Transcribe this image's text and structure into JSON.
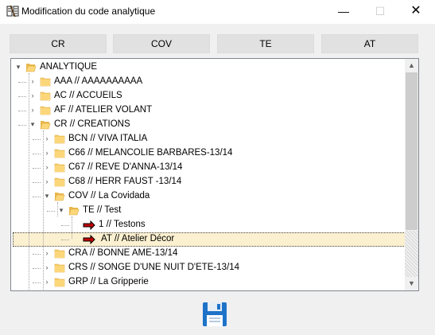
{
  "window": {
    "title": "Modification du code analytique",
    "minimize": "—",
    "maximize": "☐",
    "close": "✕"
  },
  "tabs": [
    "CR",
    "COV",
    "TE",
    "AT"
  ],
  "tree": {
    "rows": [
      {
        "label": "ANALYTIQUE",
        "icon": "folder-open-icon"
      },
      {
        "label": "AAA  // AAAAAAAAAA",
        "icon": "folder-icon"
      },
      {
        "label": "AC  // ACCUEILS",
        "icon": "folder-icon"
      },
      {
        "label": "AF  // ATELIER VOLANT",
        "icon": "folder-icon"
      },
      {
        "label": "CR  // CREATIONS",
        "icon": "folder-open-icon"
      },
      {
        "label": "BCN  // VIVA ITALIA",
        "icon": "folder-icon"
      },
      {
        "label": "C66 // MELANCOLIE BARBARES-13/14",
        "icon": "folder-icon"
      },
      {
        "label": "C67 // REVE D'ANNA-13/14",
        "icon": "folder-icon"
      },
      {
        "label": "C68 // HERR FAUST -13/14",
        "icon": "folder-icon"
      },
      {
        "label": "COV  // La Covidada",
        "icon": "folder-open-icon"
      },
      {
        "label": "TE  // Test",
        "icon": "folder-open-icon"
      },
      {
        "label": "1  // Testons",
        "icon": "red-arrow-icon"
      },
      {
        "label": "AT  // Atelier Décor",
        "icon": "red-arrow-icon"
      },
      {
        "label": "CRA // BONNE AME-13/14",
        "icon": "folder-icon"
      },
      {
        "label": "CRS // SONGE D'UNE NUIT D'ETE-13/14",
        "icon": "folder-icon"
      },
      {
        "label": "GRP  // La Gripperie",
        "icon": "folder-icon"
      }
    ]
  },
  "footer": {
    "save_icon": "floppy-disk-icon"
  }
}
